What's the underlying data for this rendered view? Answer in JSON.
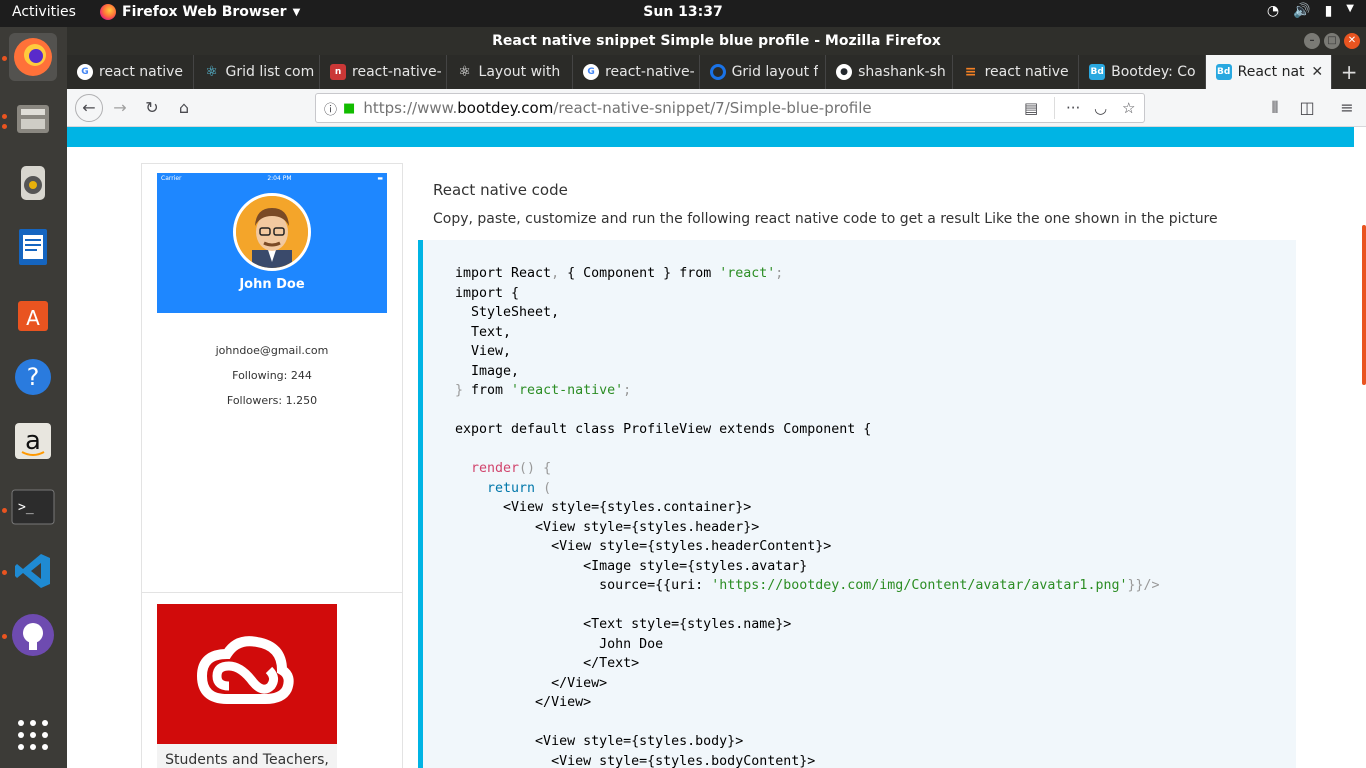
{
  "system": {
    "activities": "Activities",
    "app_menu": "Firefox Web Browser",
    "clock": "Sun 13:37"
  },
  "window": {
    "title": "React native snippet Simple blue profile - Mozilla Firefox"
  },
  "tabs": [
    {
      "label": "react native",
      "icon": "google-icon",
      "color": "#4285f4"
    },
    {
      "label": "Grid list com",
      "icon": "react-icon",
      "color": "#61dafb"
    },
    {
      "label": "react-native-",
      "icon": "npm-icon",
      "color": "#cb3837"
    },
    {
      "label": "Layout with",
      "icon": "react-icon",
      "color": "#222222"
    },
    {
      "label": "react-native-",
      "icon": "google-icon",
      "color": "#4285f4"
    },
    {
      "label": "Grid layout f",
      "icon": "circle-icon",
      "color": "#1a73e8"
    },
    {
      "label": "shashank-sh",
      "icon": "github-icon",
      "color": "#24292e"
    },
    {
      "label": "react native",
      "icon": "stackoverflow-icon",
      "color": "#f48024"
    },
    {
      "label": "Bootdey: Co",
      "icon": "bootdey-icon",
      "color": "#29a8e0"
    },
    {
      "label": "React nati",
      "icon": "bootdey-icon",
      "color": "#29a8e0",
      "active": true
    }
  ],
  "urlbar": {
    "prefix": "https://www.",
    "domain": "bootdey.com",
    "path": "/react-native-snippet/7/Simple-blue-profile"
  },
  "preview": {
    "carrier": "Carrier",
    "time": "2:04 PM",
    "name": "John Doe",
    "email": "johndoe@gmail.com",
    "following": "Following: 244",
    "followers": "Followers: 1.250"
  },
  "ad": {
    "text": "Students and Teachers,"
  },
  "section": {
    "title": "React native code",
    "description": "Copy, paste, customize and run the following react native code to get a result Like the one shown in the picture"
  },
  "code": {
    "l1a": "import React",
    "l1b": ",",
    "l1c": " { Component } ",
    "l1d": "from ",
    "l1e": "'react'",
    "l1f": ";",
    "l2": "import {",
    "l3": "  StyleSheet,",
    "l4": "  Text,",
    "l5": "  View,",
    "l6": "  Image,",
    "l7a": "} ",
    "l7b": "from ",
    "l7c": "'react-native'",
    "l7d": ";",
    "l9": "export default class ProfileView extends Component {",
    "l11a": "  render",
    "l11b": "() {",
    "l12a": "    return",
    "l12b": " (",
    "l13": "      <View style={styles.container}>",
    "l14": "          <View style={styles.header}>",
    "l15": "            <View style={styles.headerContent}>",
    "l16": "                <Image style={styles.avatar}",
    "l17a": "                  source={{uri: ",
    "l17b": "'https://bootdey.com/img/Content/avatar/avatar1.png'",
    "l17c": "}}/>",
    "l19": "                <Text style={styles.name}>",
    "l20": "                  John Doe",
    "l21": "                </Text>",
    "l22": "            </View>",
    "l23": "          </View>",
    "l25": "          <View style={styles.body}>",
    "l26": "            <View style={styles.bodyContent}>"
  }
}
